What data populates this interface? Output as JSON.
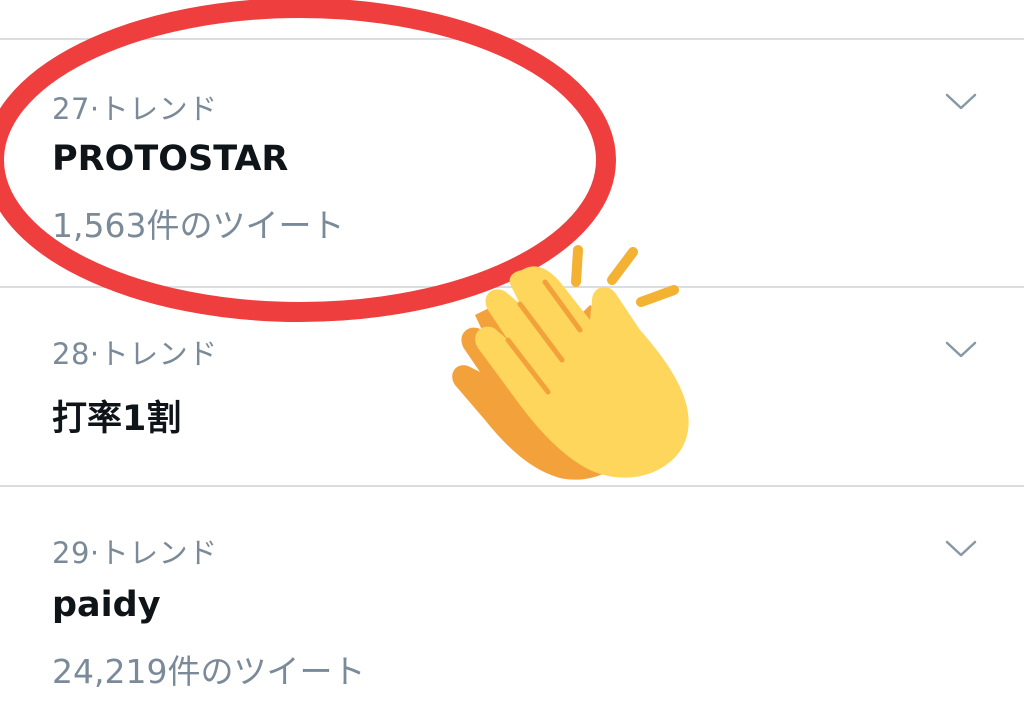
{
  "trends": [
    {
      "meta": "27·トレンド",
      "title": "PROTOSTAR",
      "count": "1,563件のツイート",
      "menu_icon": "chevron-down-icon"
    },
    {
      "meta": "28·トレンド",
      "title": "打率1割",
      "menu_icon": "chevron-down-icon"
    },
    {
      "meta": "29·トレンド",
      "title": "paidy",
      "count": "24,219件のツイート",
      "menu_icon": "chevron-down-icon"
    }
  ],
  "annotation": {
    "highlight_color": "#ee3e3e",
    "emoji_icon": "clapping-hands-icon"
  }
}
